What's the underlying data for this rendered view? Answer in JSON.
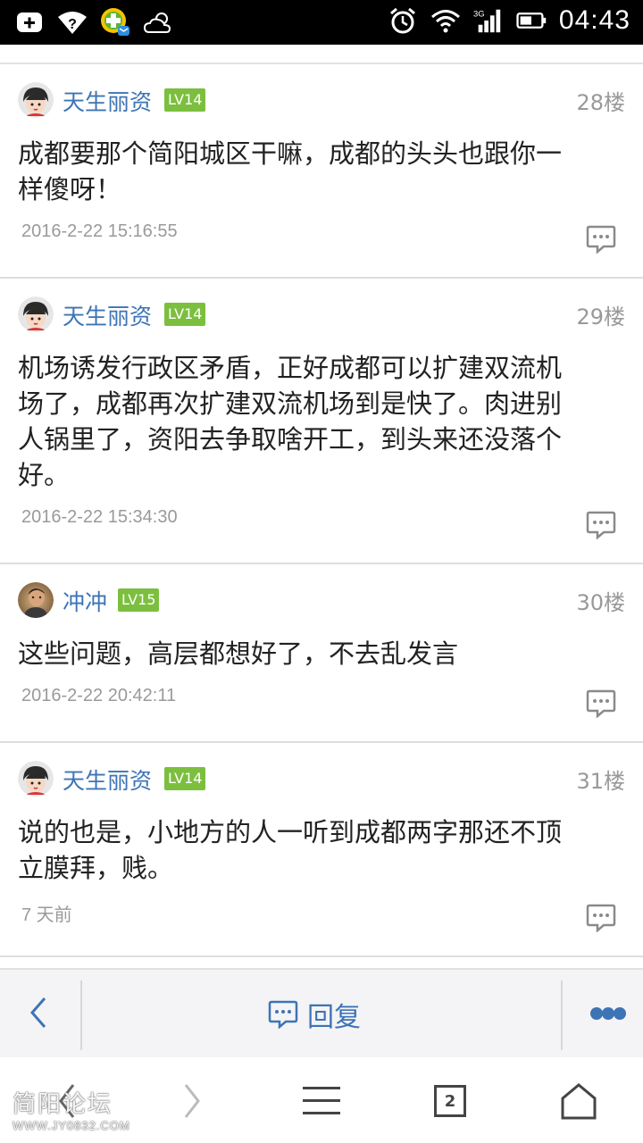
{
  "status_bar": {
    "time": "04:43"
  },
  "posts": [
    {
      "username": "天生丽资",
      "level": "LV14",
      "floor": "28楼",
      "lines": [
        "成都要那个简阳城区干嘛，成都的头头也跟你一",
        "样傻呀！"
      ],
      "time": "2016-2-22 15:16:55"
    },
    {
      "username": "天生丽资",
      "level": "LV14",
      "floor": "29楼",
      "lines": [
        "机场诱发行政区矛盾，正好成都可以扩建双流机",
        "场了，成都再次扩建双流机场到是快了。肉进别",
        "人锅里了，资阳去争取啥开工，到头来还没落个",
        "好。"
      ],
      "time": "2016-2-22 15:34:30"
    },
    {
      "username": "冲冲",
      "level": "LV15",
      "floor": "30楼",
      "lines": [
        "这些问题，高层都想好了，不去乱发言"
      ],
      "time": "2016-2-22 20:42:11"
    },
    {
      "username": "天生丽资",
      "level": "LV14",
      "floor": "31楼",
      "lines": [
        "说的也是，小地方的人一听到成都两字那还不顶",
        "立膜拜，贱。"
      ],
      "time": "7 天前"
    }
  ],
  "action_bar": {
    "reply_label": "回复"
  },
  "nav_bar": {
    "tab_count": "2"
  },
  "watermark": {
    "title": "简阳论坛",
    "url": "WWW.JY0832.COM"
  },
  "colors": {
    "link_blue": "#3d74b5",
    "level_green": "#7cbf3f",
    "meta_gray": "#9a9a9a"
  }
}
